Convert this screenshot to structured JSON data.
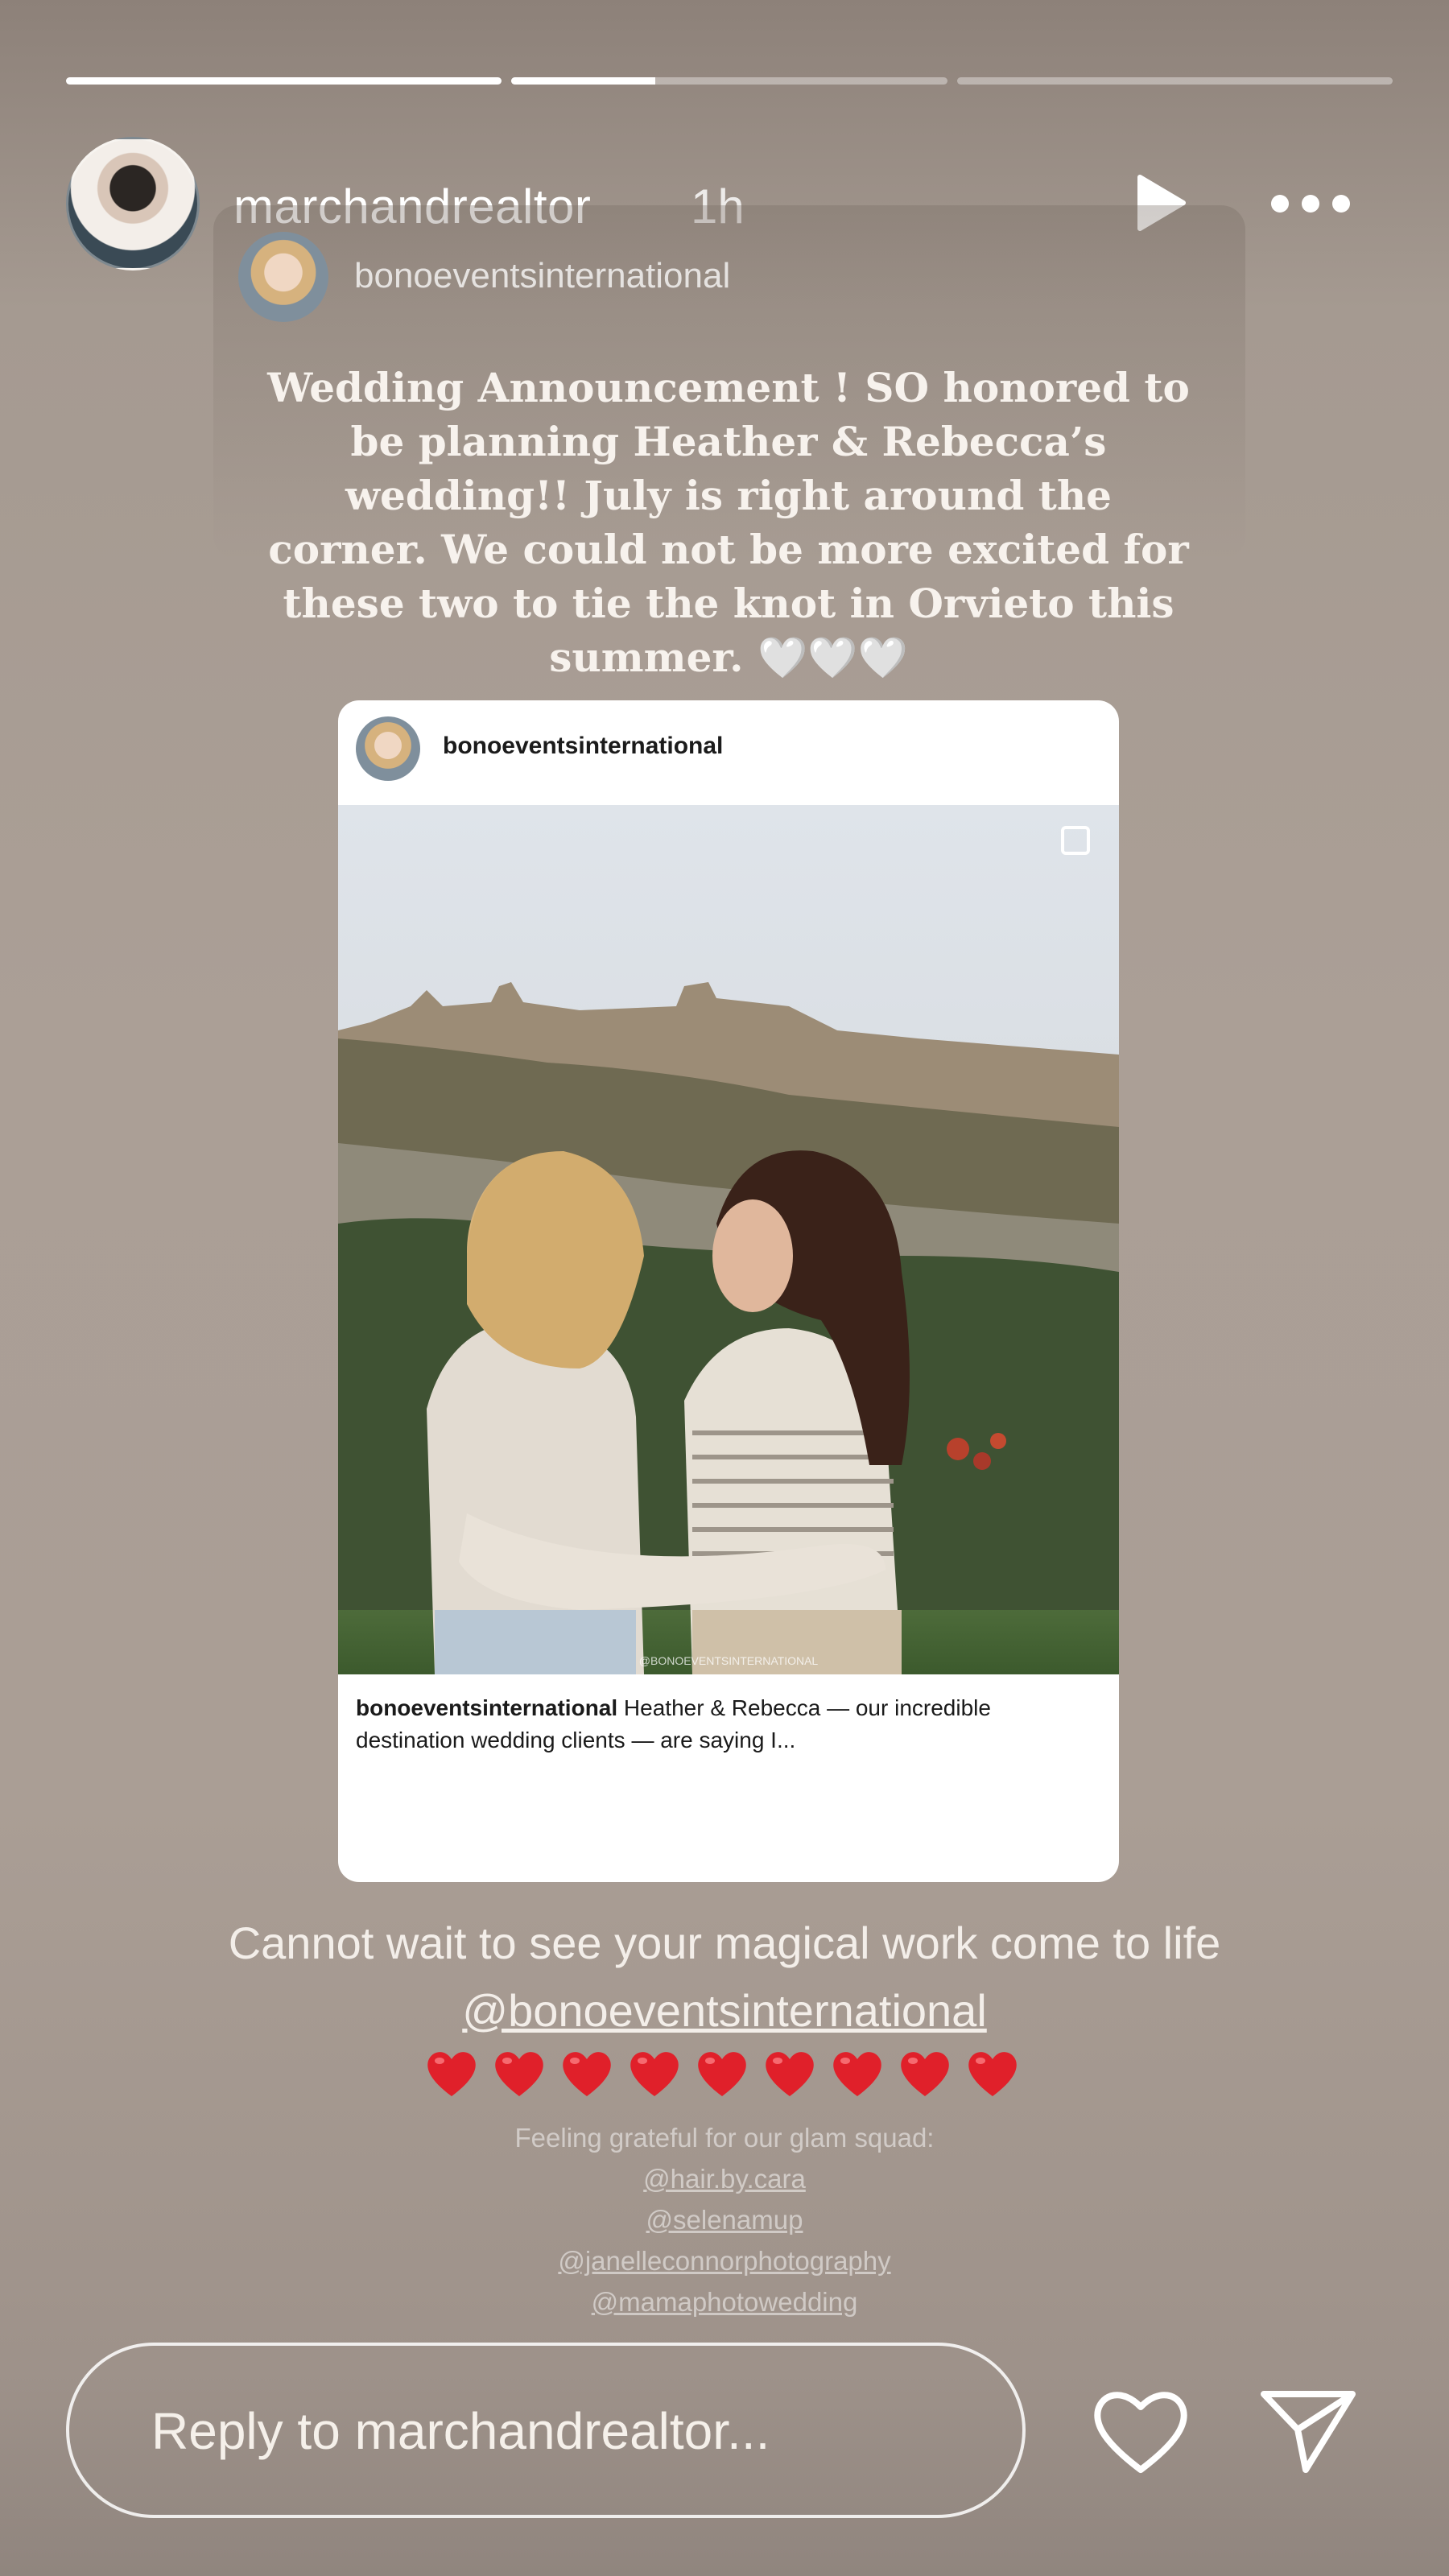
{
  "story": {
    "progress": [
      1.0,
      0.33,
      0.0
    ],
    "author": "marchandrealtor",
    "time": "1h"
  },
  "shared_post": {
    "account": "bonoeventsinternational",
    "announcement": "Wedding Announcement ! SO honored to be planning Heather & Rebecca’s wedding!! July is right around the corner. We could not be more excited for these two to tie the knot in Orvieto this summer. 🤍🤍🤍",
    "card": {
      "account": "bonoeventsinternational",
      "watermark": "@BONOEVENTSINTERNATIONAL",
      "caption_account": "bonoeventsinternational",
      "caption_text": " Heather & Rebecca — our incredible destination wedding clients — are saying I..."
    }
  },
  "comment": {
    "text": "Cannot wait to see your magical work come to life ",
    "mention": "@bonoeventsinternational",
    "hearts_count": 9
  },
  "glam": {
    "intro": "Feeling grateful for our glam squad:",
    "tags": [
      "@hair.by.cara",
      "@selenamup",
      "@janelleconnorphotography",
      "@mamaphotowedding"
    ]
  },
  "reply": {
    "placeholder": "Reply to marchandrealtor..."
  }
}
